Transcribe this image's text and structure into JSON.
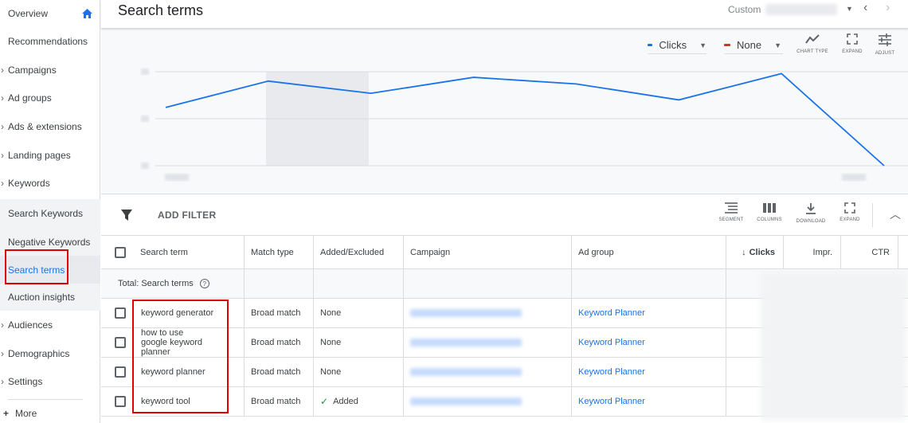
{
  "sidebar": {
    "items": [
      {
        "label": "Overview"
      },
      {
        "label": "Recommendations"
      },
      {
        "label": "Campaigns"
      },
      {
        "label": "Ad groups"
      },
      {
        "label": "Ads & extensions"
      },
      {
        "label": "Landing pages"
      },
      {
        "label": "Keywords"
      },
      {
        "label": "Search Keywords"
      },
      {
        "label": "Negative Keywords"
      },
      {
        "label": "Search terms"
      },
      {
        "label": "Auction insights"
      },
      {
        "label": "Audiences"
      },
      {
        "label": "Demographics"
      },
      {
        "label": "Settings"
      }
    ],
    "more_label": "More"
  },
  "header": {
    "title": "Search terms",
    "date_label": "Custom"
  },
  "chart_toolbar": {
    "metric1": "Clicks",
    "metric2": "None",
    "chart_type": "CHART TYPE",
    "expand": "EXPAND",
    "adjust": "ADJUST"
  },
  "colors": {
    "accent": "#1a73e8",
    "metric2": "#d93025",
    "annotation": "#e00000"
  },
  "chart_data": {
    "type": "line",
    "series": [
      {
        "name": "Clicks",
        "values": [
          0.62,
          0.9,
          0.77,
          0.94,
          0.87,
          0.7,
          0.98,
          0.0
        ]
      }
    ],
    "ylim": [
      0,
      1
    ],
    "grid": true,
    "highlight_band": [
      1,
      2
    ]
  },
  "filter_bar": {
    "add_filter": "ADD FILTER",
    "segment": "SEGMENT",
    "columns": "COLUMNS",
    "download": "DOWNLOAD",
    "expand": "EXPAND"
  },
  "table": {
    "headers": {
      "search_term": "Search term",
      "match_type": "Match type",
      "added_excluded": "Added/Excluded",
      "campaign": "Campaign",
      "ad_group": "Ad group",
      "clicks": "Clicks",
      "impr": "Impr.",
      "ctr": "CTR"
    },
    "total_label": "Total: Search terms",
    "rows": [
      {
        "term": "keyword generator",
        "match": "Broad match",
        "status": "None",
        "ad_group": "Keyword Planner"
      },
      {
        "term": "how to use google keyword planner",
        "match": "Broad match",
        "status": "None",
        "ad_group": "Keyword Planner"
      },
      {
        "term": "keyword planner",
        "match": "Broad match",
        "status": "None",
        "ad_group": "Keyword Planner"
      },
      {
        "term": "keyword tool",
        "match": "Broad match",
        "status": "Added",
        "ad_group": "Keyword Planner"
      }
    ]
  }
}
